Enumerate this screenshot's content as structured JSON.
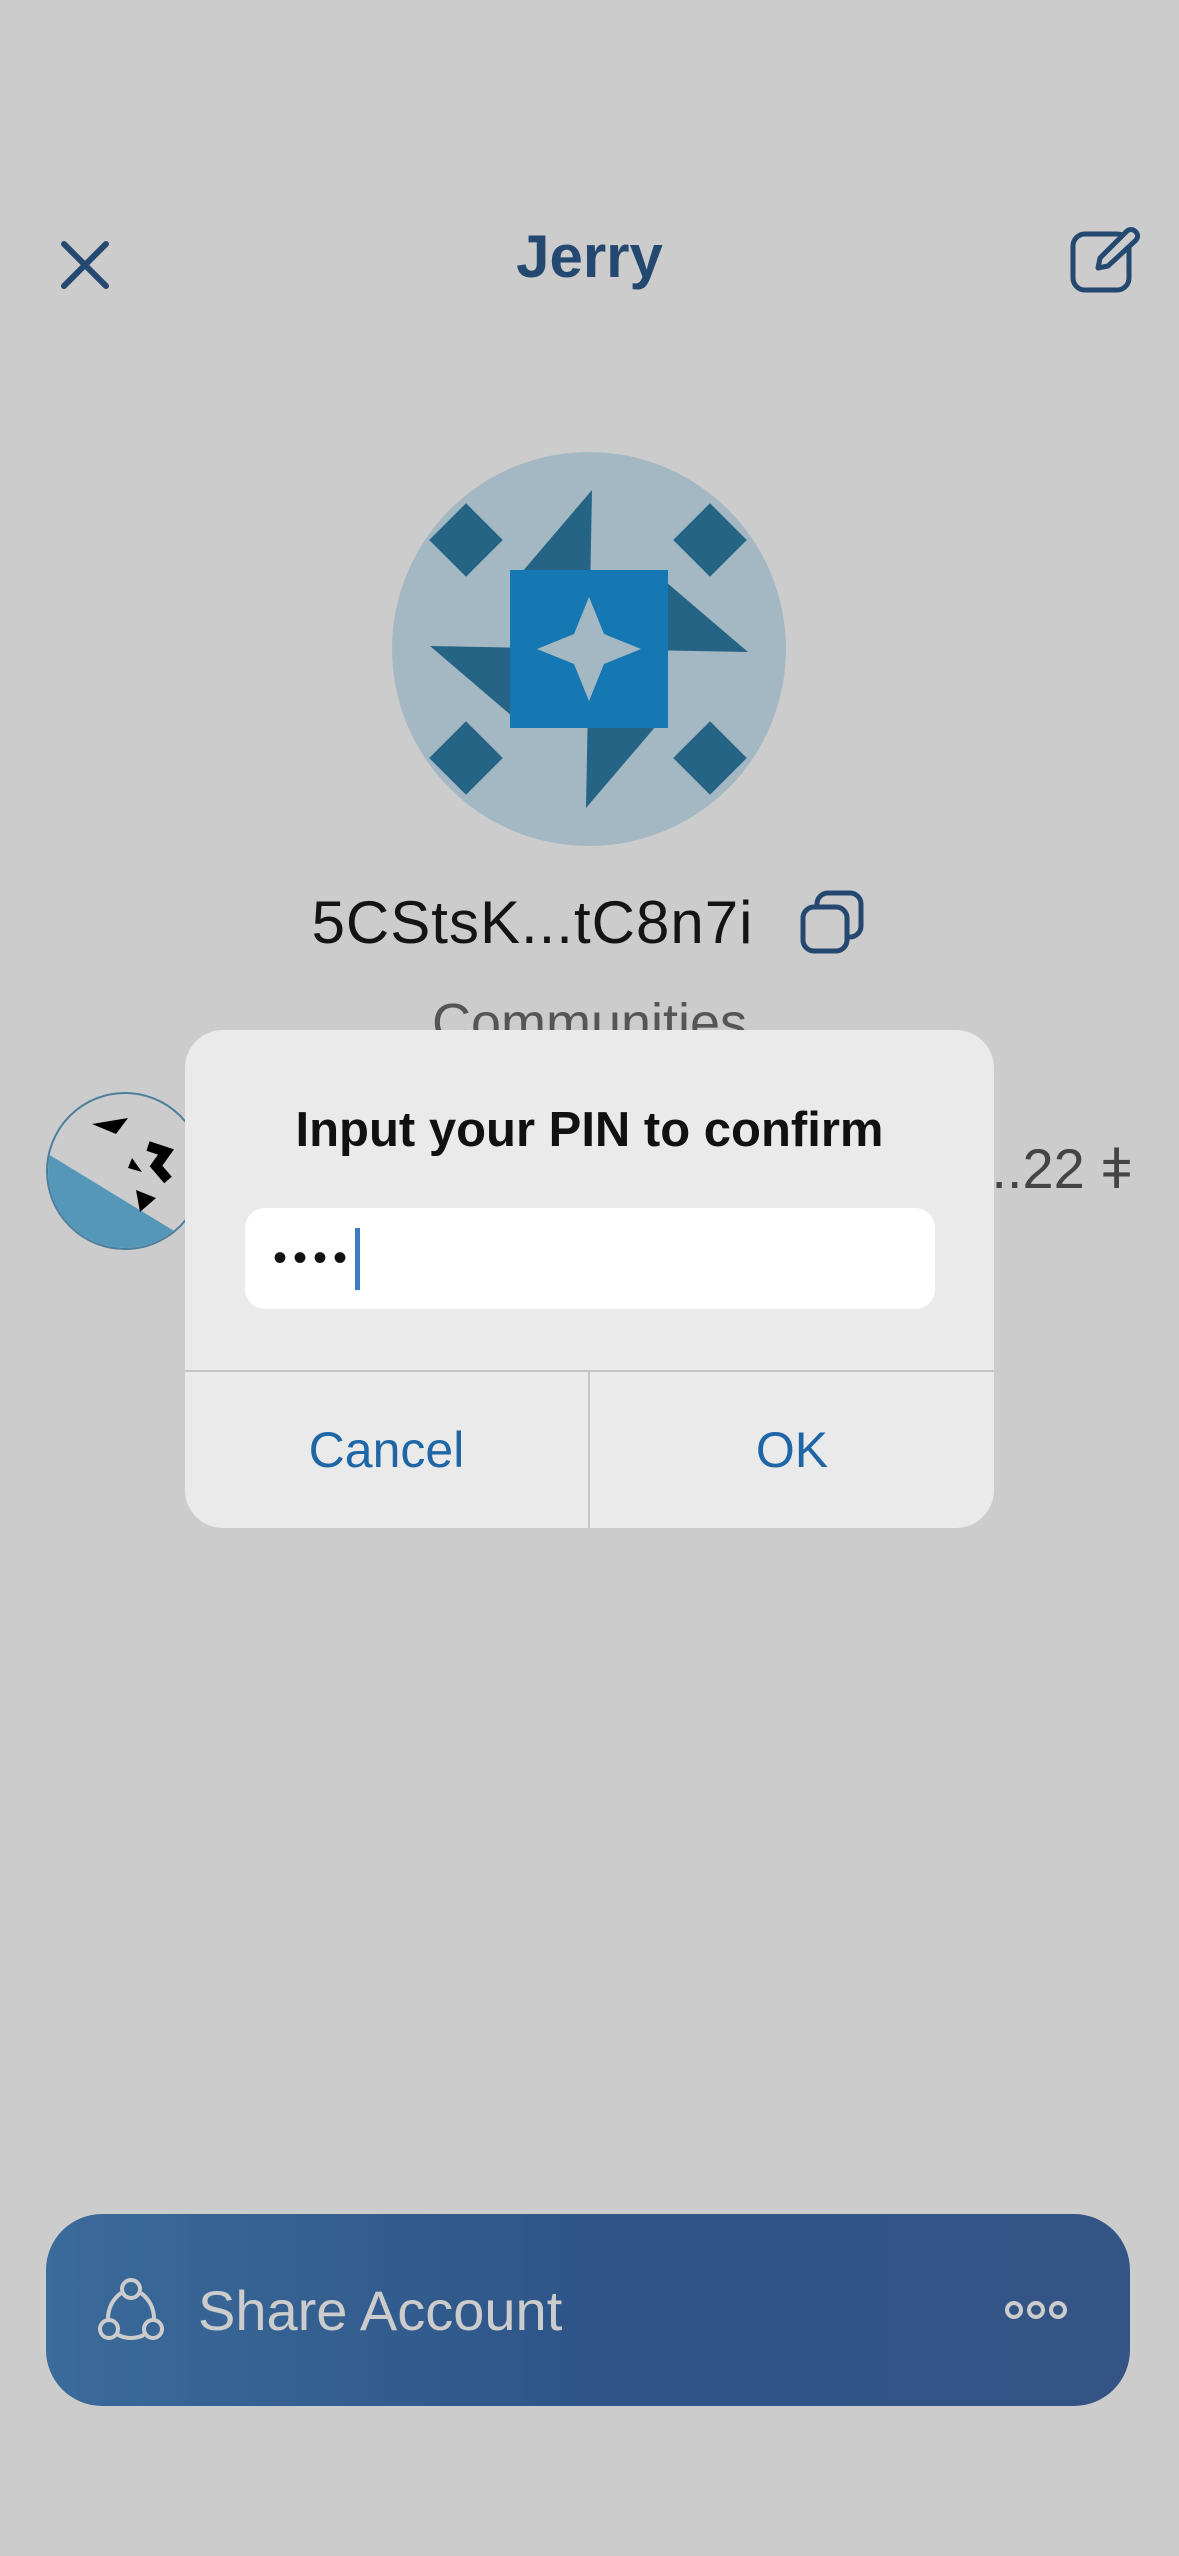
{
  "header": {
    "title": "Jerry"
  },
  "account": {
    "address": "5CStsK...tC8n7i"
  },
  "communities": {
    "section_title": "Communities",
    "items": [
      {
        "balance": "...22 ǂ"
      }
    ]
  },
  "share_bar": {
    "label": "Share Account"
  },
  "dialog": {
    "title": "Input your PIN to confirm",
    "pin_value": "••••",
    "cancel_label": "Cancel",
    "ok_label": "OK"
  },
  "icons": [
    "close-icon",
    "edit-icon",
    "copy-icon",
    "share-icon",
    "more-icon"
  ],
  "colors": {
    "accent": "#2f5a8c",
    "share_bar": "#4a86c1",
    "dialog_button": "#1f66a6"
  }
}
